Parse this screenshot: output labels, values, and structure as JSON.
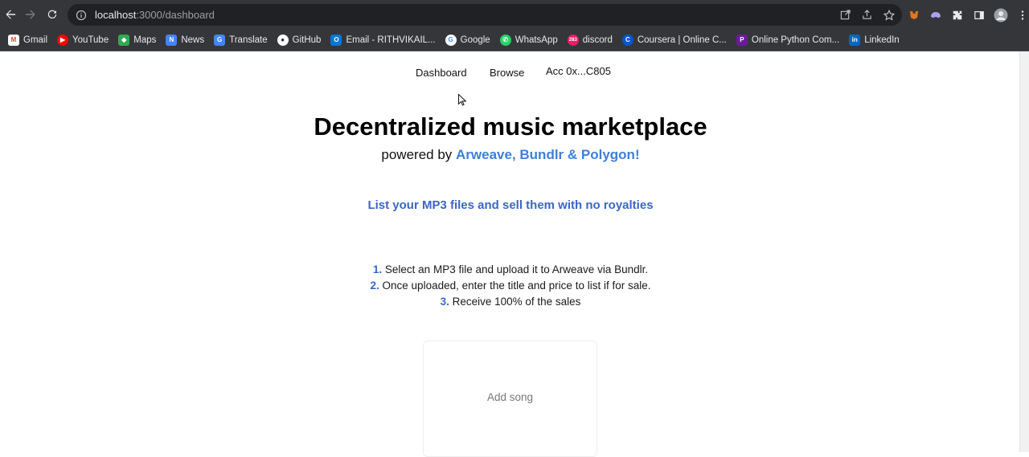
{
  "browser": {
    "url_host": "localhost",
    "url_path": ":3000/dashboard",
    "bookmarks": [
      {
        "label": "Gmail",
        "color": "#ea4335",
        "glyph": "M"
      },
      {
        "label": "YouTube",
        "color": "#ff0000",
        "glyph": "▶"
      },
      {
        "label": "Maps",
        "color": "#34a853",
        "glyph": "◆"
      },
      {
        "label": "News",
        "color": "#4285f4",
        "glyph": "N"
      },
      {
        "label": "Translate",
        "color": "#4285f4",
        "glyph": "G"
      },
      {
        "label": "GitHub",
        "color": "#24292e",
        "glyph": "●"
      },
      {
        "label": "Email - RITHVIKAIL...",
        "color": "#0078d4",
        "glyph": "O"
      },
      {
        "label": "Google",
        "color": "#ffffff",
        "glyph": "G"
      },
      {
        "label": "WhatsApp",
        "color": "#25d366",
        "glyph": "✆"
      },
      {
        "label": "discord",
        "color": "#e91e63",
        "glyph": "283"
      },
      {
        "label": "Coursera | Online C...",
        "color": "#0056d2",
        "glyph": "C"
      },
      {
        "label": "Online Python Com...",
        "color": "#6a1b9a",
        "glyph": "P"
      },
      {
        "label": "LinkedIn",
        "color": "#0a66c2",
        "glyph": "in"
      }
    ]
  },
  "nav": {
    "dashboard": "Dashboard",
    "browse": "Browse",
    "account": "Acc 0x...C805"
  },
  "hero": {
    "title": "Decentralized music marketplace",
    "subtitle_prefix": "powered by ",
    "subtitle_highlight": "Arweave, Bundlr & Polygon!",
    "tagline": "List your MP3 files and sell them with no royalties"
  },
  "steps": [
    {
      "num": "1.",
      "text": " Select an MP3 file and upload it to Arweave via Bundlr."
    },
    {
      "num": "2.",
      "text": " Once uploaded, enter the title and price to list if for sale."
    },
    {
      "num": "3.",
      "text": " Receive 100% of the sales"
    }
  ],
  "add_card": {
    "label": "Add song"
  },
  "colors": {
    "accent": "#3f7fd6",
    "tagline": "#3b66c4",
    "chrome": "#35363a"
  }
}
